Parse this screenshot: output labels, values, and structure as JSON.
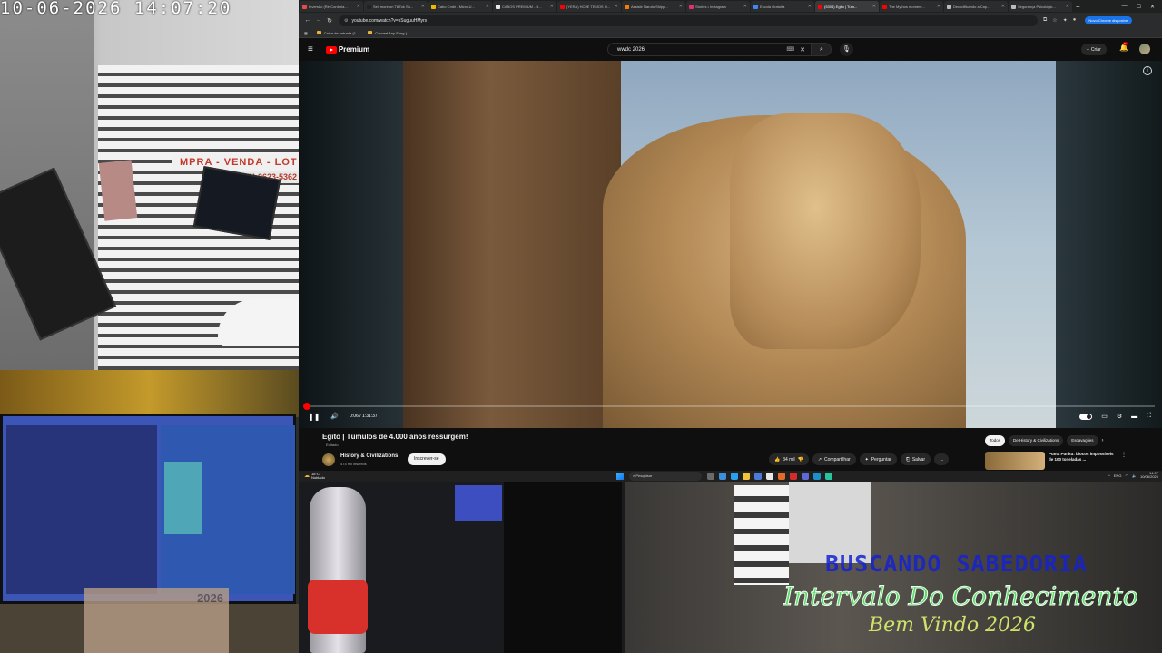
{
  "camera": {
    "timestamp": "10-06-2026 14:07:20",
    "sign_text": "MPRA - VENDA - LOT",
    "sign_phone": "(11) 2623-5362"
  },
  "browser": {
    "tabs": [
      {
        "label": "Inversão (Ré)Controla...",
        "color": "#e54b4b"
      },
      {
        "label": "Sell more on TikTok Sh...",
        "color": "#222222"
      },
      {
        "label": "Cabo Cmbi - Micro-U...",
        "color": "#f2b705"
      },
      {
        "label": "CABOS PREMIUM - B...",
        "color": "#e8e8e8"
      },
      {
        "label": "(YERA) HOJE TEMOS O...",
        "color": "#ff0000"
      },
      {
        "label": "Assistir Naruto Shipp...",
        "color": "#f57c00"
      },
      {
        "label": "Stories • Instagram",
        "color": "#e1306c"
      },
      {
        "label": "Escola Gratuita",
        "color": "#4285f4"
      },
      {
        "label": "(5304) Egito | Túm...",
        "color": "#ff0000",
        "active": true
      },
      {
        "label": "The Mythos moment...",
        "color": "#ff0000"
      },
      {
        "label": "Decodificando a Cap...",
        "color": "#bbbbbb"
      },
      {
        "label": "Segurança Psicológic...",
        "color": "#bbbbbb"
      }
    ],
    "new_tab": "+",
    "url": "youtube.com/watch?v=sSuguuHMyrs",
    "update_button": "Novo Chrome disponível",
    "bookmarks": [
      "Caixa de entrada (1...",
      "Convert Any Song (..."
    ]
  },
  "youtube": {
    "logo_text": "Premium",
    "search_value": "wwdc 2026",
    "create_label": "Criar",
    "notifications_badge": "9+",
    "player": {
      "current_time": "0:06",
      "duration": "1:31:37",
      "time_display": "0:06 / 1:31:37",
      "progress_fraction": 0.001
    },
    "video_title": "Egito | Túmulos de 4.000 anos ressurgem!",
    "verified_label": "Editado",
    "channel": {
      "name": "History & Civilizations",
      "subscribers": "474 mil inscritos",
      "subscribe_label": "Inscrever-se"
    },
    "actions": {
      "likes": "34 mil",
      "share": "Compartilhar",
      "ask": "Perguntar",
      "save": "Salvar",
      "more": "..."
    },
    "chips": [
      "Todos",
      "De History & Civilizations",
      "Escavações"
    ],
    "recommended": {
      "title": "Puma Punku: blocos impossíveis de 100 toneladas ..."
    }
  },
  "taskbar": {
    "weather_temp": "18°C",
    "weather_desc": "Nublado",
    "search_placeholder": "Pesquisar",
    "lang": "ENG",
    "time": "14:07",
    "date": "10/06/2026"
  },
  "overlay": {
    "line1": "BUSCANDO SABEDORIA",
    "line2": "Intervalo Do Conhecimento",
    "line3": "Bem Vindo 2026"
  },
  "webcam": {
    "calendar_year": "2026"
  }
}
